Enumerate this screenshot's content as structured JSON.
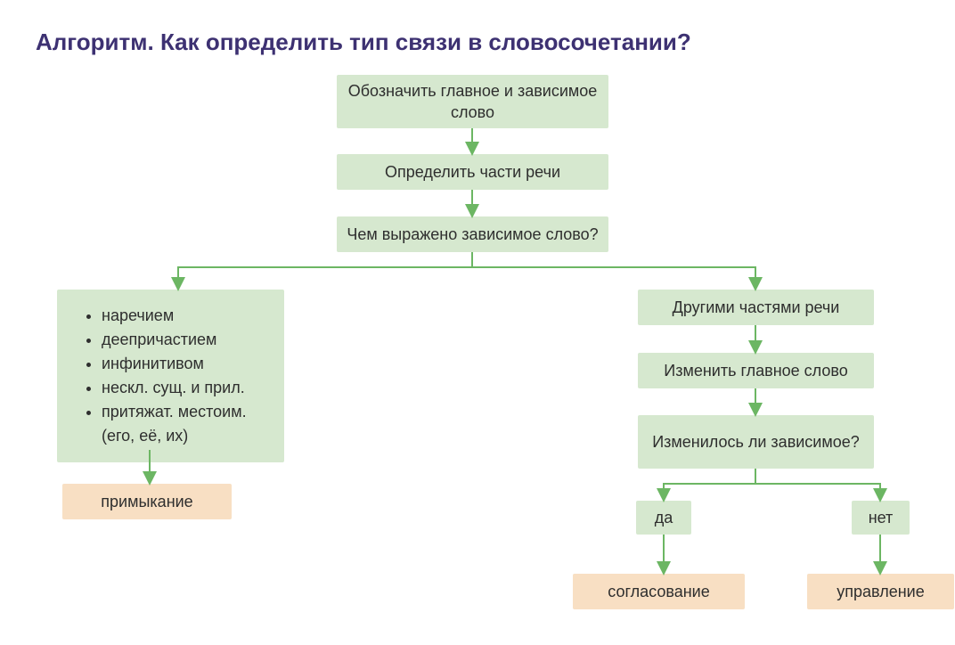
{
  "title": "Алгоритм. Как определить тип связи в словосочетании?",
  "top1": "Обозначить главное и зависимое слово",
  "top2": "Определить части речи",
  "top3": "Чем выражено зависимое слово?",
  "leftList": {
    "i1": "наречием",
    "i2": "деепричастием",
    "i3": "инфинитивом",
    "i4": "нескл. сущ. и прил.",
    "i5": "притяжат. местоим. (его, её, их)"
  },
  "leftResult": "примыкание",
  "right1": "Другими частями речи",
  "right2": "Изменить главное слово",
  "right3": "Изменилось ли зависимое?",
  "yes": "да",
  "no": "нет",
  "resYes": "согласование",
  "resNo": "управление",
  "colors": {
    "green": "#d6e8cf",
    "orange": "#f8dfc3",
    "arrow": "#6cb663",
    "title": "#3d3172"
  }
}
